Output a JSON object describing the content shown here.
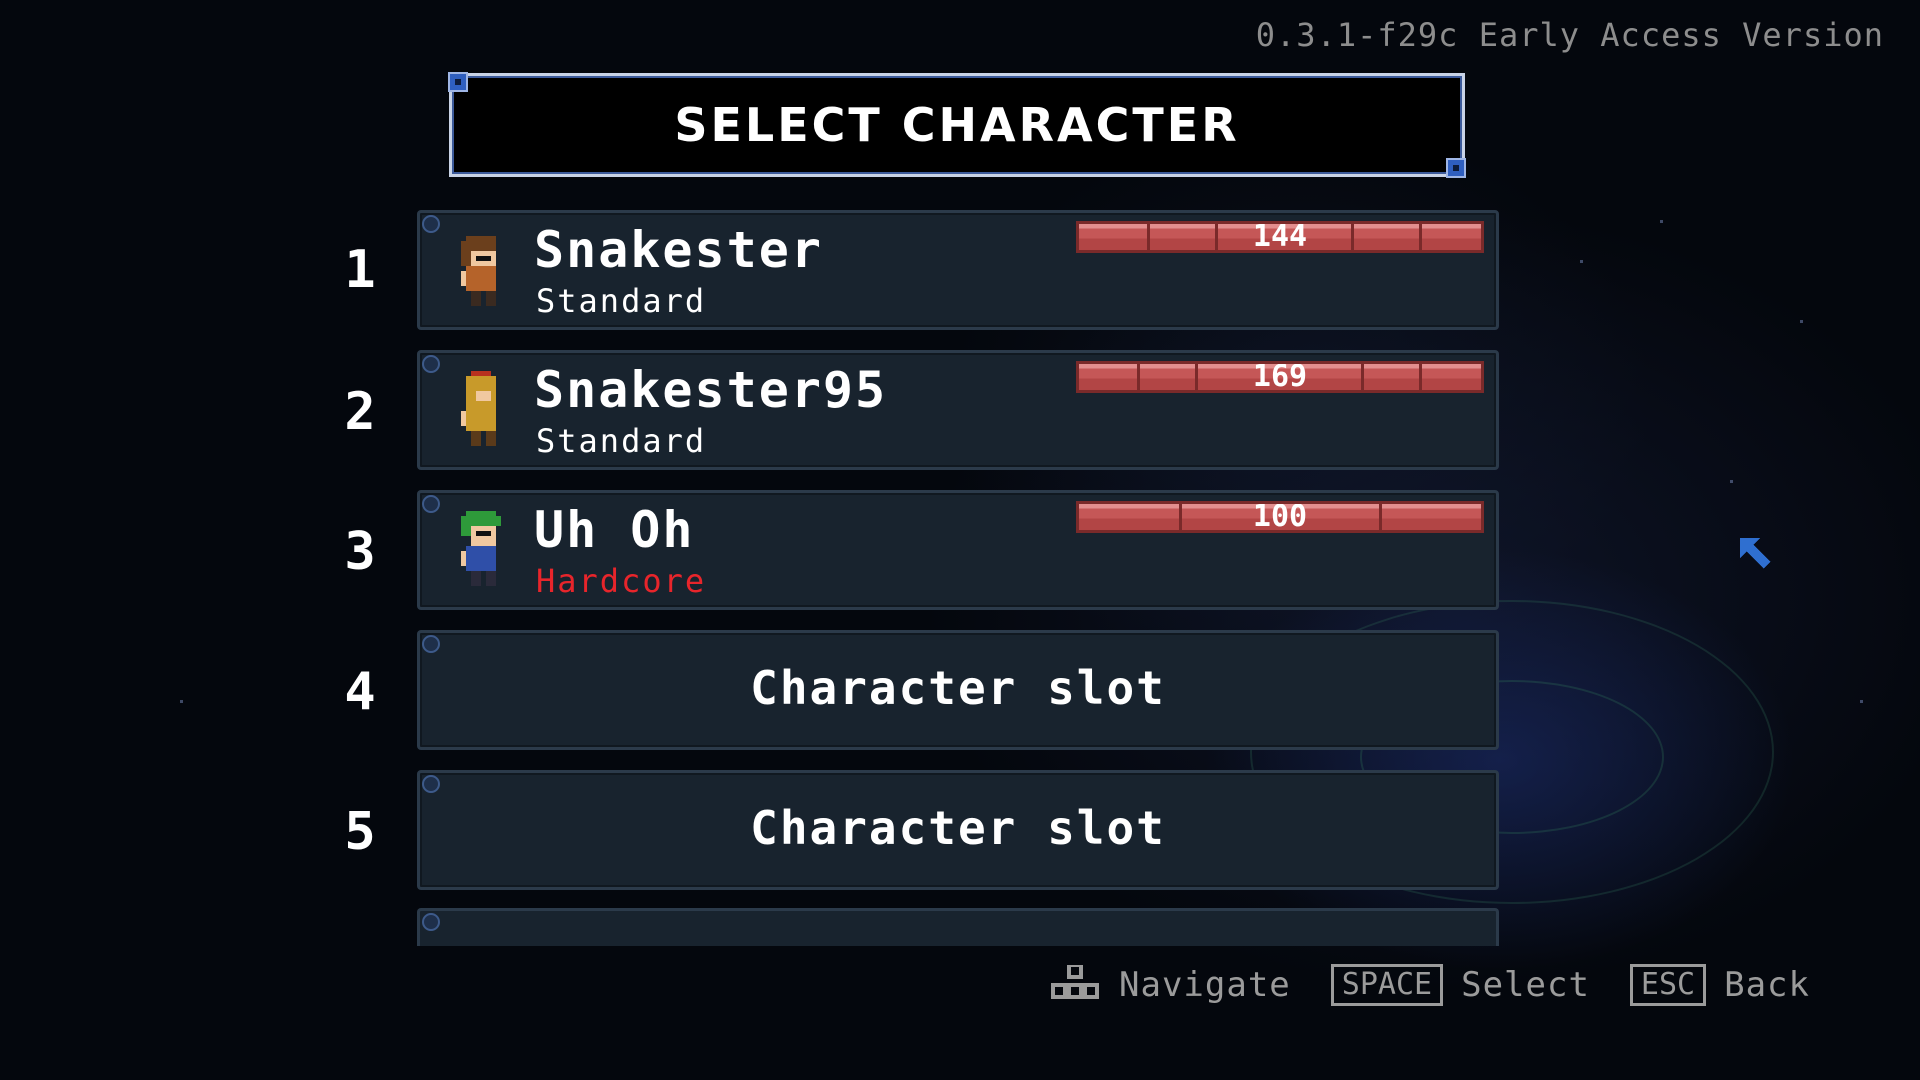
{
  "version_text": "0.3.1-f29c Early Access Version",
  "title": "SELECT CHARACTER",
  "characters": [
    {
      "slot": "1",
      "name": "Snakester",
      "mode": "Standard",
      "mode_color": "#ffffff",
      "hp": "144",
      "hp_fraction": 1.0,
      "hair_color": "#6b3f1c",
      "outfit_color": "#b5632a"
    },
    {
      "slot": "2",
      "name": "Snakester95",
      "mode": "Standard",
      "mode_color": "#ffffff",
      "hp": "169",
      "hp_fraction": 1.0,
      "hair_color": "#b8311f",
      "outfit_color": "#c89a2a"
    },
    {
      "slot": "3",
      "name": "Uh Oh",
      "mode": "Hardcore",
      "mode_color": "#e8252b",
      "hp": "100",
      "hp_fraction": 1.0,
      "hair_color": "#2e9a3a",
      "outfit_color": "#2f4fa8"
    }
  ],
  "empty_slots": [
    {
      "slot": "4",
      "label": "Character slot"
    },
    {
      "slot": "5",
      "label": "Character slot"
    }
  ],
  "controls": {
    "navigate_icon": "dpad-icon",
    "navigate_label": "Navigate",
    "select_key": "SPACE",
    "select_label": "Select",
    "back_key": "ESC",
    "back_label": "Back"
  },
  "colors": {
    "card_bg": "#18232e",
    "hp_bar": "#c55757",
    "cursor": "#2f6fd0"
  }
}
